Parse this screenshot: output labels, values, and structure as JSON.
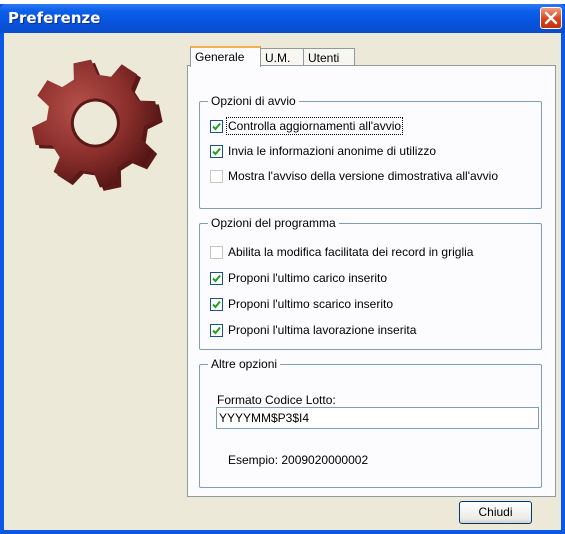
{
  "window": {
    "title": "Preferenze",
    "close_icon": "close-icon"
  },
  "tabs": [
    {
      "label": "Generale",
      "active": true
    },
    {
      "label": "U.M.",
      "active": false
    },
    {
      "label": "Utenti",
      "active": false
    }
  ],
  "startup": {
    "title": "Opzioni di avvio",
    "options": [
      {
        "label": "Controlla aggiornamenti all'avvio",
        "checked": true
      },
      {
        "label": "Invia le informazioni anonime di utilizzo",
        "checked": true
      },
      {
        "label": "Mostra l'avviso della versione dimostrativa all'avvio",
        "checked": false
      }
    ]
  },
  "program": {
    "title": "Opzioni del programma",
    "options": [
      {
        "label": "Abilita la modifica facilitata dei record in griglia",
        "checked": false
      },
      {
        "label": "Proponi l'ultimo carico inserito",
        "checked": true
      },
      {
        "label": "Proponi l'ultimo scarico inserito",
        "checked": true
      },
      {
        "label": "Proponi l'ultima lavorazione inserita",
        "checked": true
      }
    ]
  },
  "other": {
    "title": "Altre opzioni",
    "lot_label": "Formato Codice Lotto:",
    "lot_value": "YYYYMM$P3$I4",
    "example": "Esempio: 2009020000002"
  },
  "buttons": {
    "close": "Chiudi"
  },
  "colors": {
    "title_bar": "#0754e0",
    "dialog_bg": "#ece9d8",
    "gear": "#8b2f2c"
  }
}
